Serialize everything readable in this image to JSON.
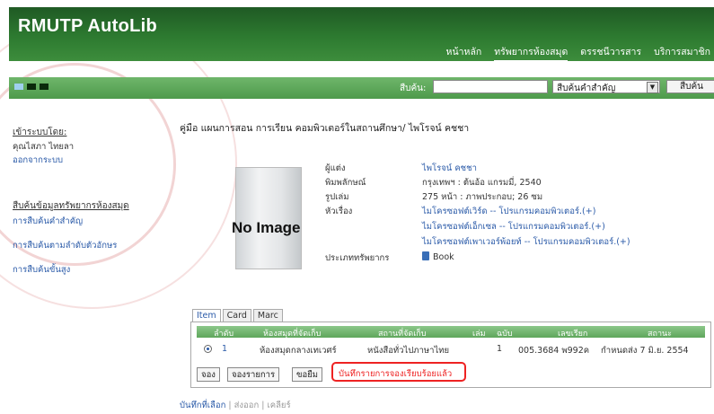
{
  "app": {
    "logo": "RMUTP AutoLib"
  },
  "nav": {
    "items": [
      {
        "label": "หน้าหลัก",
        "active": false
      },
      {
        "label": "ทรัพยากรห้องสมุด",
        "active": true
      },
      {
        "label": "ดรรชนีวารสาร",
        "active": false
      },
      {
        "label": "บริการสมาชิก",
        "active": false
      }
    ]
  },
  "search": {
    "label": "สืบค้น:",
    "input_value": "",
    "select_value": "สืบค้นคำสำคัญ",
    "button_label": "สืบค้น"
  },
  "header_squares": [
    "#9fd0ee",
    "#0b2a0b",
    "#0b2a0b"
  ],
  "sidebar": {
    "login_heading": "เข้าระบบโดย:",
    "user_name": "คุณไสภา ไทยลา",
    "logout_label": "ออกจากระบบ",
    "search_heading": "สืบค้นข้อมูลทรัพยากรห้องสมุด",
    "links": [
      "การสืบค้นคำสำคัญ",
      "การสืบค้นตามลำดับตัวอักษร",
      "การสืบค้นขั้นสูง"
    ]
  },
  "record": {
    "title": "คู่มือ แผนการสอน การเรียน คอมพิวเตอร์ในสถานศึกษา/ ไพโรจน์ คชชา",
    "no_image": "No Image",
    "labels": {
      "author": "ผู้แต่ง",
      "publisher": "พิมพลักษณ์",
      "format": "รูปเล่ม",
      "subject": "หัวเรื่อง",
      "resource_type": "ประเภททรัพยากร"
    },
    "author": "ไพโรจน์ คชชา",
    "publisher": "กรุงเทพฯ : ต้นอ้อ แกรมมี่, 2540",
    "format": "275 หน้า : ภาพประกอบ; 26 ซม",
    "subjects": [
      "ไมโครซอฟต์เวิร์ด -- โปรแกรมคอมพิวเตอร์.(+)",
      "ไมโครซอฟต์เอ็กเซล -- โปรแกรมคอมพิวเตอร์.(+)",
      "ไมโครซอฟต์เพาเวอร์พ้อยท์ -- โปรแกรมคอมพิวเตอร์.(+)"
    ],
    "resource_type": "Book"
  },
  "tabs": [
    {
      "label": "Item",
      "active": true
    },
    {
      "label": "Card",
      "active": false
    },
    {
      "label": "Marc",
      "active": false
    }
  ],
  "items_table": {
    "columns": [
      "ลำดับ",
      "ห้องสมุดที่จัดเก็บ",
      "สถานที่จัดเก็บ",
      "เล่ม",
      "ฉบับ",
      "เลขเรียก",
      "สถานะ"
    ],
    "rows": [
      {
        "seq": "1",
        "library": "ห้องสมุดกลางเทเวศร์",
        "location": "หนังสือทั่วไปภาษาไทย",
        "volume": "",
        "copy": "1",
        "call_no": "005.3684 พ992ค",
        "status": "กำหนดส่ง 7 มิ.ย. 2554"
      }
    ]
  },
  "buttons": {
    "reserve": "จอง",
    "reserve_list": "จองรายการ",
    "borrow": "ขอยืม"
  },
  "message": "บันทึกรายการจองเรียบร้อยแล้ว",
  "footer": {
    "save": "บันทึกที่เลือก",
    "export": "ส่งออก",
    "clear": "เคลียร์"
  },
  "colors": {
    "header_green": "#2d7a30",
    "link_blue": "#2a5aa8",
    "alert_red": "#e22222"
  }
}
